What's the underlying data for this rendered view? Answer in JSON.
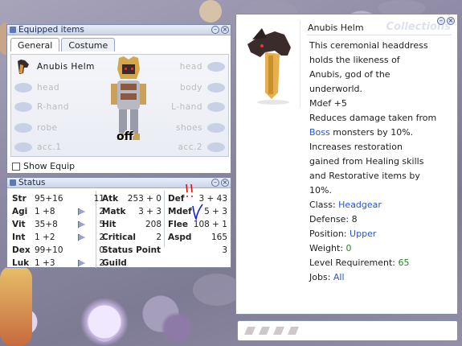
{
  "equip": {
    "title": "Equipped items",
    "tabs": [
      "General",
      "Costume"
    ],
    "item_name": "Anubis Helm",
    "slots_left": [
      "head",
      "R-hand",
      "robe",
      "acc.1"
    ],
    "slots_right": [
      "head",
      "body",
      "L-hand",
      "shoes",
      "acc.2"
    ],
    "off_label": "off",
    "show_equip_label": "Show Equip"
  },
  "status": {
    "title": "Status",
    "stats": [
      {
        "name": "Str",
        "value": "95+16",
        "points": "11"
      },
      {
        "name": "Agi",
        "value": "1 +8",
        "points": "2"
      },
      {
        "name": "Vit",
        "value": "35+8",
        "points": "5"
      },
      {
        "name": "Int",
        "value": "1 +2",
        "points": "2"
      },
      {
        "name": "Dex",
        "value": "99+10",
        "points": "0"
      },
      {
        "name": "Luk",
        "value": "1 +3",
        "points": "2"
      }
    ],
    "mid": [
      {
        "name": "Atk",
        "value": "253 + 0"
      },
      {
        "name": "Matk",
        "value": "3 + 3"
      },
      {
        "name": "Hit",
        "value": "208"
      },
      {
        "name": "Critical",
        "value": "2"
      },
      {
        "name": "Status Point",
        "value": "3"
      },
      {
        "name": "Guild",
        "value": ""
      }
    ],
    "right": [
      {
        "name": "Def",
        "value": "3 + 43"
      },
      {
        "name": "Mdef",
        "value": "5 + 3"
      },
      {
        "name": "Flee",
        "value": "108 + 1"
      },
      {
        "name": "Aspd",
        "value": "165"
      }
    ]
  },
  "info": {
    "watermark": "Collections",
    "name": "Anubis Helm",
    "lines": [
      "This ceremonial headdress",
      "holds the likeness of",
      "Anubis, god of the",
      "underworld."
    ],
    "mdef": "Mdef +5",
    "effect_1": "Reduces damage taken from",
    "boss": "Boss",
    "effect_2": " monsters by 10%.",
    "effect_3": "Increases restoration",
    "effect_4": "gained from Healing skills",
    "effect_5": "and Restorative items by",
    "effect_6": "10%.",
    "class_label": "Class: ",
    "class_value": "Headgear",
    "defense_label": "Defense: ",
    "defense_value": "8",
    "position_label": "Position: ",
    "position_value": "Upper",
    "weight_label": "Weight: ",
    "weight_value": "0",
    "level_label": "Level Requirement: ",
    "level_value": "65",
    "jobs_label": "Jobs: ",
    "jobs_value": "All"
  },
  "colors": {
    "blue_text": "#2955c8",
    "green_text": "#1e8a1e",
    "annotation_red": "#e01010",
    "annotation_blue": "#1020d8"
  },
  "icons": {
    "window_buttons": [
      "minimize-icon",
      "close-icon"
    ],
    "info_buttons": [
      "minimize-icon",
      "close-icon"
    ]
  }
}
